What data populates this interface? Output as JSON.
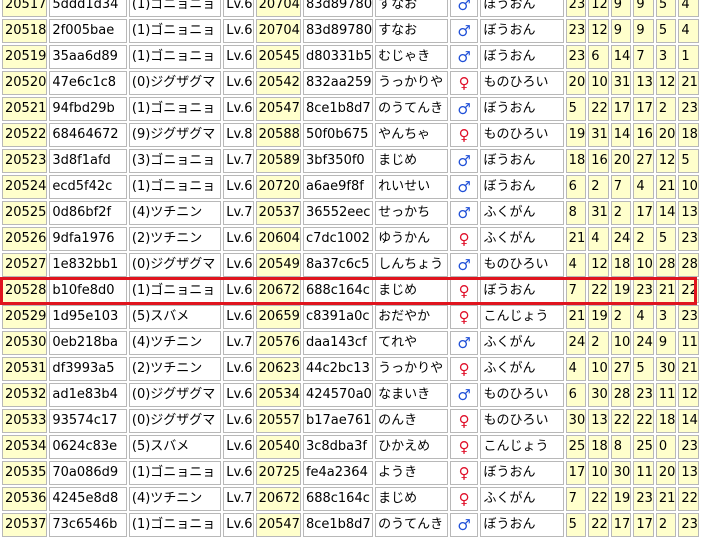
{
  "columns": [
    "id",
    "hash",
    "pokemon",
    "level",
    "partner_id",
    "partner_hash",
    "nature",
    "gender",
    "ability",
    "iv_hp",
    "iv_atk",
    "iv_def",
    "iv_spa",
    "iv_spd",
    "iv_spe"
  ],
  "highlight_color": "#e0141e",
  "male_color": "#1f4fd8",
  "female_color": "#e0102a",
  "gender_symbols": {
    "male": "♂",
    "female": "♀"
  },
  "rows": [
    {
      "id": "20517",
      "hash": "5ddd1d34",
      "pokemon": "(1)ゴニョニョ",
      "level": "Lv.6",
      "partner_id": "20704",
      "partner_hash": "83d89780",
      "nature": "すなお",
      "gender": "♂",
      "gender_type": "male",
      "ability": "ぼうおん",
      "ivs": [
        "23",
        "12",
        "9",
        "9",
        "5",
        "4"
      ]
    },
    {
      "id": "20518",
      "hash": "2f005bae",
      "pokemon": "(1)ゴニョニョ",
      "level": "Lv.6",
      "partner_id": "20704",
      "partner_hash": "83d89780",
      "nature": "すなお",
      "gender": "♂",
      "gender_type": "male",
      "ability": "ぼうおん",
      "ivs": [
        "23",
        "12",
        "9",
        "9",
        "5",
        "4"
      ]
    },
    {
      "id": "20519",
      "hash": "35aa6d89",
      "pokemon": "(1)ゴニョニョ",
      "level": "Lv.6",
      "partner_id": "20545",
      "partner_hash": "d80331b5",
      "nature": "むじゃき",
      "gender": "♂",
      "gender_type": "male",
      "ability": "ぼうおん",
      "ivs": [
        "23",
        "6",
        "14",
        "7",
        "3",
        "1"
      ]
    },
    {
      "id": "20520",
      "hash": "47e6c1c8",
      "pokemon": "(0)ジグザグマ",
      "level": "Lv.6",
      "partner_id": "20542",
      "partner_hash": "832aa259",
      "nature": "うっかりや",
      "gender": "♀",
      "gender_type": "female",
      "ability": "ものひろい",
      "ivs": [
        "20",
        "10",
        "31",
        "13",
        "12",
        "21"
      ]
    },
    {
      "id": "20521",
      "hash": "94fbd29b",
      "pokemon": "(1)ゴニョニョ",
      "level": "Lv.6",
      "partner_id": "20547",
      "partner_hash": "8ce1b8d7",
      "nature": "のうてんき",
      "gender": "♂",
      "gender_type": "male",
      "ability": "ぼうおん",
      "ivs": [
        "5",
        "22",
        "17",
        "17",
        "2",
        "23"
      ]
    },
    {
      "id": "20522",
      "hash": "68464672",
      "pokemon": "(9)ジグザグマ",
      "level": "Lv.8",
      "partner_id": "20588",
      "partner_hash": "50f0b675",
      "nature": "やんちゃ",
      "gender": "♀",
      "gender_type": "female",
      "ability": "ものひろい",
      "ivs": [
        "19",
        "31",
        "14",
        "16",
        "20",
        "18"
      ]
    },
    {
      "id": "20523",
      "hash": "3d8f1afd",
      "pokemon": "(3)ゴニョニョ",
      "level": "Lv.7",
      "partner_id": "20589",
      "partner_hash": "3bf350f0",
      "nature": "まじめ",
      "gender": "♂",
      "gender_type": "male",
      "ability": "ぼうおん",
      "ivs": [
        "18",
        "16",
        "20",
        "27",
        "12",
        "5"
      ]
    },
    {
      "id": "20524",
      "hash": "ecd5f42c",
      "pokemon": "(1)ゴニョニョ",
      "level": "Lv.6",
      "partner_id": "20720",
      "partner_hash": "a6ae9f8f",
      "nature": "れいせい",
      "gender": "♂",
      "gender_type": "male",
      "ability": "ぼうおん",
      "ivs": [
        "6",
        "2",
        "7",
        "4",
        "21",
        "10"
      ]
    },
    {
      "id": "20525",
      "hash": "0d86bf2f",
      "pokemon": "(4)ツチニン",
      "level": "Lv.7",
      "partner_id": "20537",
      "partner_hash": "36552eec",
      "nature": "せっかち",
      "gender": "♂",
      "gender_type": "male",
      "ability": "ふくがん",
      "ivs": [
        "8",
        "31",
        "2",
        "17",
        "14",
        "13"
      ]
    },
    {
      "id": "20526",
      "hash": "9dfa1976",
      "pokemon": "(2)ツチニン",
      "level": "Lv.6",
      "partner_id": "20604",
      "partner_hash": "c7dc1002",
      "nature": "ゆうかん",
      "gender": "♀",
      "gender_type": "female",
      "ability": "ふくがん",
      "ivs": [
        "21",
        "4",
        "24",
        "2",
        "5",
        "23"
      ]
    },
    {
      "id": "20527",
      "hash": "1e832bb1",
      "pokemon": "(0)ジグザグマ",
      "level": "Lv.6",
      "partner_id": "20549",
      "partner_hash": "8a37c6c5",
      "nature": "しんちょう",
      "gender": "♂",
      "gender_type": "male",
      "ability": "ものひろい",
      "ivs": [
        "4",
        "12",
        "18",
        "10",
        "28",
        "28"
      ]
    },
    {
      "id": "20528",
      "hash": "b10fe8d0",
      "pokemon": "(1)ゴニョニョ",
      "level": "Lv.6",
      "partner_id": "20672",
      "partner_hash": "688c164c",
      "nature": "まじめ",
      "gender": "♀",
      "gender_type": "female",
      "ability": "ぼうおん",
      "ivs": [
        "7",
        "22",
        "19",
        "23",
        "21",
        "22"
      ],
      "highlighted": true
    },
    {
      "id": "20529",
      "hash": "1d95e103",
      "pokemon": "(5)スバメ",
      "level": "Lv.6",
      "partner_id": "20659",
      "partner_hash": "c8391a0c",
      "nature": "おだやか",
      "gender": "♀",
      "gender_type": "female",
      "ability": "こんじょう",
      "ivs": [
        "21",
        "19",
        "2",
        "4",
        "3",
        "23"
      ]
    },
    {
      "id": "20530",
      "hash": "0eb218ba",
      "pokemon": "(4)ツチニン",
      "level": "Lv.7",
      "partner_id": "20576",
      "partner_hash": "daa143cf",
      "nature": "てれや",
      "gender": "♂",
      "gender_type": "male",
      "ability": "ふくがん",
      "ivs": [
        "24",
        "2",
        "10",
        "24",
        "9",
        "11"
      ]
    },
    {
      "id": "20531",
      "hash": "df3993a5",
      "pokemon": "(2)ツチニン",
      "level": "Lv.6",
      "partner_id": "20623",
      "partner_hash": "44c2bc13",
      "nature": "うっかりや",
      "gender": "♀",
      "gender_type": "female",
      "ability": "ふくがん",
      "ivs": [
        "4",
        "10",
        "27",
        "5",
        "30",
        "21"
      ]
    },
    {
      "id": "20532",
      "hash": "ad1e83b4",
      "pokemon": "(0)ジグザグマ",
      "level": "Lv.6",
      "partner_id": "20534",
      "partner_hash": "424570a0",
      "nature": "なまいき",
      "gender": "♂",
      "gender_type": "male",
      "ability": "ものひろい",
      "ivs": [
        "6",
        "30",
        "28",
        "23",
        "11",
        "12"
      ]
    },
    {
      "id": "20533",
      "hash": "93574c17",
      "pokemon": "(0)ジグザグマ",
      "level": "Lv.6",
      "partner_id": "20557",
      "partner_hash": "b17ae761",
      "nature": "のんき",
      "gender": "♀",
      "gender_type": "female",
      "ability": "ものひろい",
      "ivs": [
        "30",
        "13",
        "22",
        "22",
        "18",
        "14"
      ]
    },
    {
      "id": "20534",
      "hash": "0624c83e",
      "pokemon": "(5)スバメ",
      "level": "Lv.6",
      "partner_id": "20540",
      "partner_hash": "3c8dba3f",
      "nature": "ひかえめ",
      "gender": "♀",
      "gender_type": "female",
      "ability": "こんじょう",
      "ivs": [
        "25",
        "18",
        "8",
        "25",
        "0",
        "23"
      ]
    },
    {
      "id": "20535",
      "hash": "70a086d9",
      "pokemon": "(1)ゴニョニョ",
      "level": "Lv.6",
      "partner_id": "20725",
      "partner_hash": "fe4a2364",
      "nature": "ようき",
      "gender": "♀",
      "gender_type": "female",
      "ability": "ぼうおん",
      "ivs": [
        "17",
        "10",
        "30",
        "11",
        "20",
        "13"
      ]
    },
    {
      "id": "20536",
      "hash": "4245e8d8",
      "pokemon": "(4)ツチニン",
      "level": "Lv.7",
      "partner_id": "20672",
      "partner_hash": "688c164c",
      "nature": "まじめ",
      "gender": "♀",
      "gender_type": "female",
      "ability": "ふくがん",
      "ivs": [
        "7",
        "22",
        "19",
        "23",
        "21",
        "22"
      ]
    },
    {
      "id": "20537",
      "hash": "73c6546b",
      "pokemon": "(1)ゴニョニョ",
      "level": "Lv.6",
      "partner_id": "20547",
      "partner_hash": "8ce1b8d7",
      "nature": "のうてんき",
      "gender": "♂",
      "gender_type": "male",
      "ability": "ぼうおん",
      "ivs": [
        "5",
        "22",
        "17",
        "17",
        "2",
        "23"
      ]
    }
  ]
}
